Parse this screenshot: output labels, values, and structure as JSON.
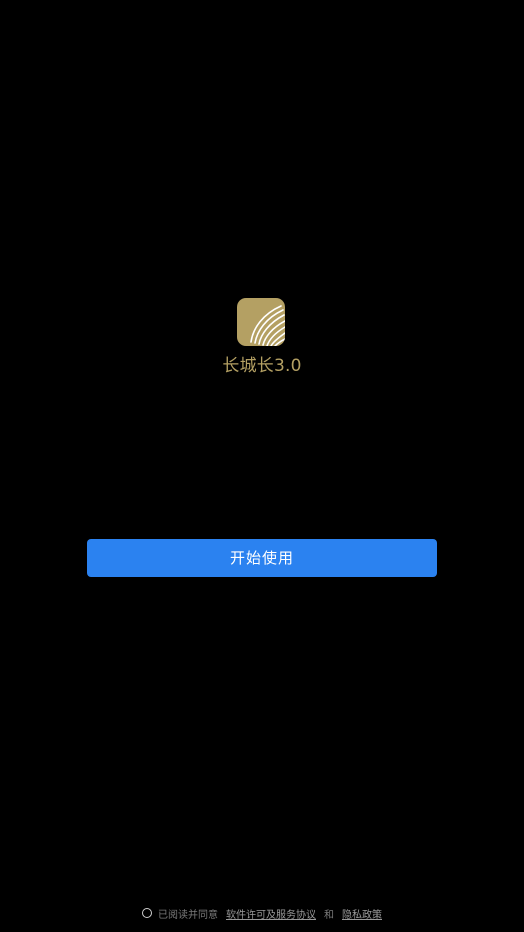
{
  "app": {
    "name": "长城长3.0",
    "logo_icon": "striped-leaf-icon",
    "brand_color": "#b4a063"
  },
  "start_button": {
    "label": "开始使用",
    "color": "#2b82f0"
  },
  "agreement": {
    "checked": false,
    "prefix": "已阅读并同意",
    "license_link": "软件许可及服务协议",
    "conjunction": "和",
    "privacy_link": "隐私政策"
  }
}
